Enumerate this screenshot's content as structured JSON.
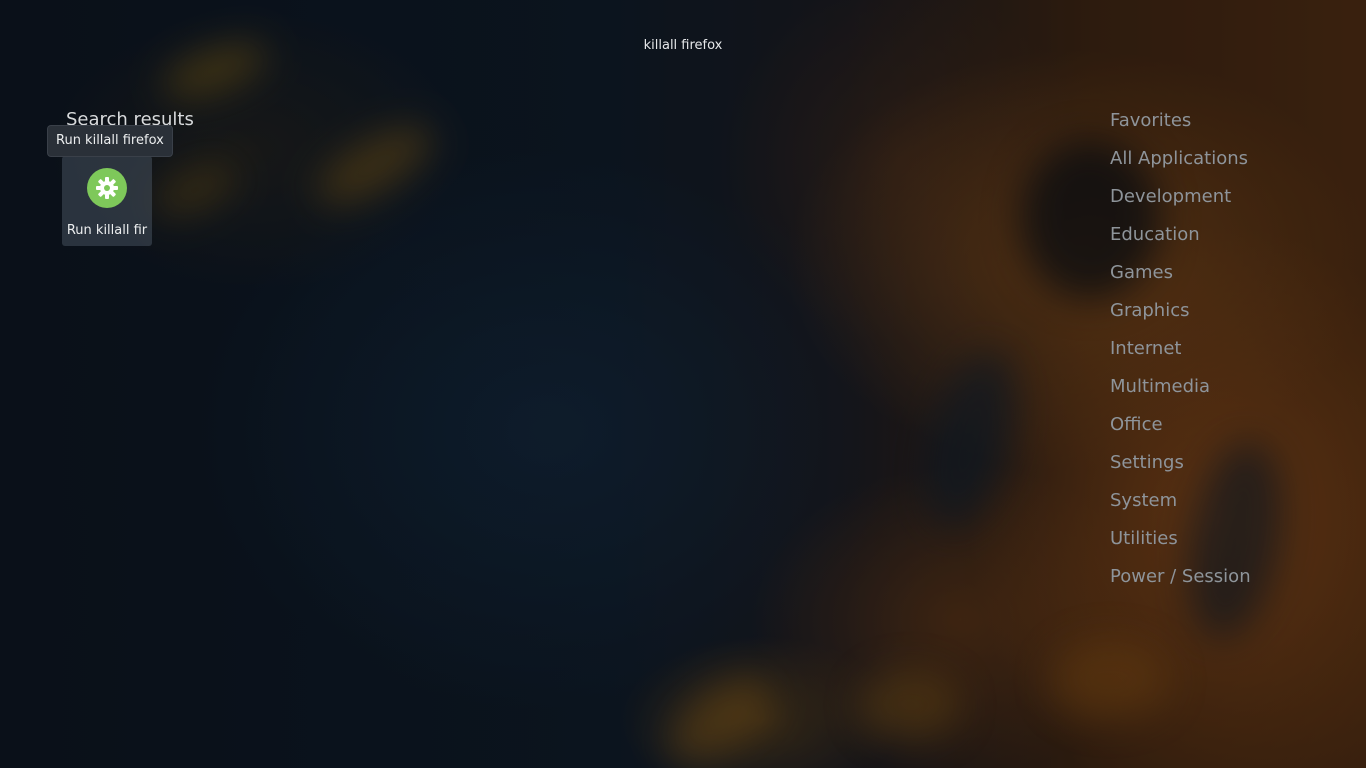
{
  "search": {
    "query": "killall firefox"
  },
  "results": {
    "title": "Search results",
    "items": [
      {
        "label": "Run killall fir",
        "tooltip": "Run killall firefox",
        "icon": "gear-icon",
        "icon_color": "#7ec85a"
      }
    ]
  },
  "categories": [
    "Favorites",
    "All Applications",
    "Development",
    "Education",
    "Games",
    "Graphics",
    "Internet",
    "Multimedia",
    "Office",
    "Settings",
    "System",
    "Utilities",
    "Power / Session"
  ]
}
